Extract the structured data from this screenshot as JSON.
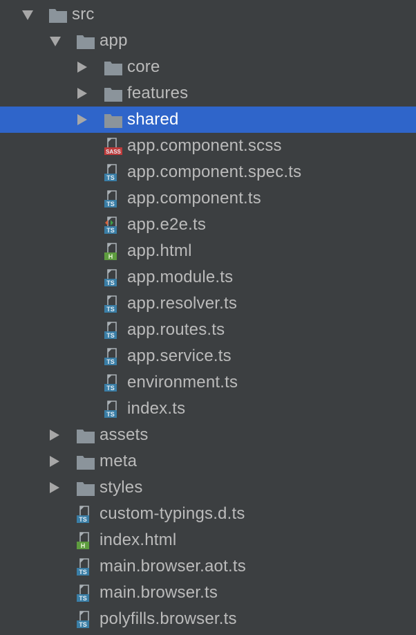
{
  "colors": {
    "background": "#3c3f41",
    "selection": "#2f65ca",
    "text": "#bbbbbb",
    "selected_text": "#ffffff",
    "folder": "#8b949b",
    "ts_badge": "#3a7ea6",
    "sass_badge": "#bf3b3b",
    "html_badge": "#5e9c3f"
  },
  "tree": [
    {
      "label": "src",
      "depth": 0,
      "type": "folder",
      "state": "expanded"
    },
    {
      "label": "app",
      "depth": 1,
      "type": "folder",
      "state": "expanded"
    },
    {
      "label": "core",
      "depth": 2,
      "type": "folder",
      "state": "collapsed"
    },
    {
      "label": "features",
      "depth": 2,
      "type": "folder",
      "state": "collapsed"
    },
    {
      "label": "shared",
      "depth": 2,
      "type": "folder",
      "state": "collapsed",
      "selected": true
    },
    {
      "label": "app.component.scss",
      "depth": 2,
      "type": "sass",
      "badge": "SASS"
    },
    {
      "label": "app.component.spec.ts",
      "depth": 2,
      "type": "ts",
      "badge": "TS"
    },
    {
      "label": "app.component.ts",
      "depth": 2,
      "type": "ts",
      "badge": "TS"
    },
    {
      "label": "app.e2e.ts",
      "depth": 2,
      "type": "e2e",
      "badge": "TS"
    },
    {
      "label": "app.html",
      "depth": 2,
      "type": "html",
      "badge": "H"
    },
    {
      "label": "app.module.ts",
      "depth": 2,
      "type": "ts",
      "badge": "TS"
    },
    {
      "label": "app.resolver.ts",
      "depth": 2,
      "type": "ts",
      "badge": "TS"
    },
    {
      "label": "app.routes.ts",
      "depth": 2,
      "type": "ts",
      "badge": "TS"
    },
    {
      "label": "app.service.ts",
      "depth": 2,
      "type": "ts",
      "badge": "TS"
    },
    {
      "label": "environment.ts",
      "depth": 2,
      "type": "ts",
      "badge": "TS"
    },
    {
      "label": "index.ts",
      "depth": 2,
      "type": "ts",
      "badge": "TS"
    },
    {
      "label": "assets",
      "depth": 1,
      "type": "folder",
      "state": "collapsed"
    },
    {
      "label": "meta",
      "depth": 1,
      "type": "folder",
      "state": "collapsed"
    },
    {
      "label": "styles",
      "depth": 1,
      "type": "folder",
      "state": "collapsed"
    },
    {
      "label": "custom-typings.d.ts",
      "depth": 1,
      "type": "ts",
      "badge": "TS"
    },
    {
      "label": "index.html",
      "depth": 1,
      "type": "html",
      "badge": "H"
    },
    {
      "label": "main.browser.aot.ts",
      "depth": 1,
      "type": "ts",
      "badge": "TS"
    },
    {
      "label": "main.browser.ts",
      "depth": 1,
      "type": "ts",
      "badge": "TS"
    },
    {
      "label": "polyfills.browser.ts",
      "depth": 1,
      "type": "ts",
      "badge": "TS"
    }
  ]
}
